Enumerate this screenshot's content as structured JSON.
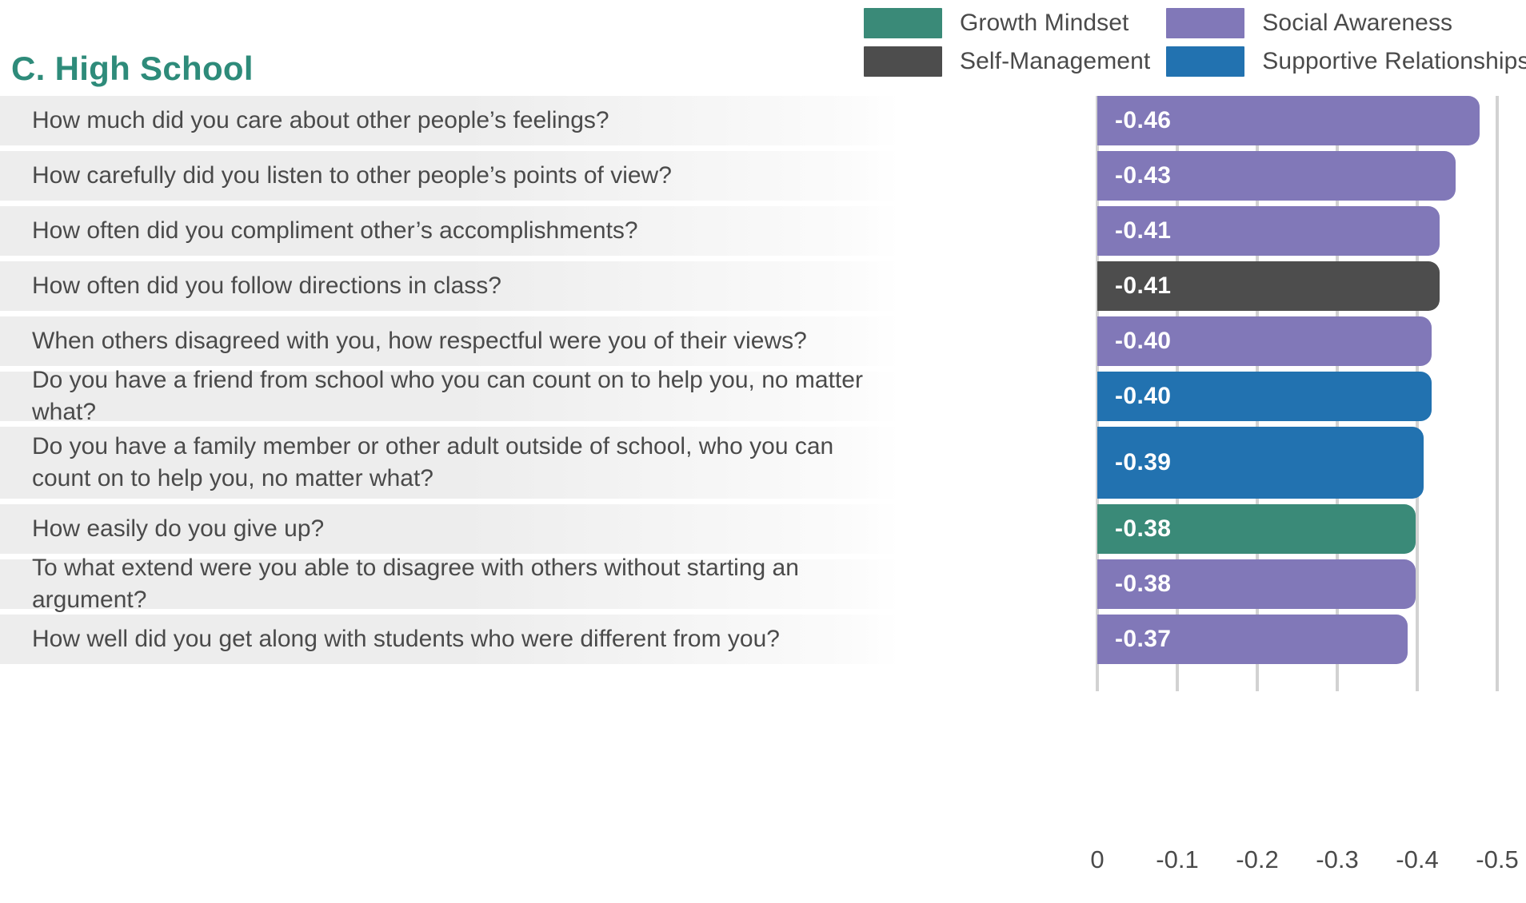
{
  "title": "C. High School",
  "legend": {
    "items": [
      {
        "label": "Growth Mindset",
        "color": "#3a8a78"
      },
      {
        "label": "Social Awareness",
        "color": "#8178b8"
      },
      {
        "label": "Self-Management",
        "color": "#4d4d4d"
      },
      {
        "label": "Supportive Relationships",
        "color": "#2272b0"
      }
    ]
  },
  "chart_data": {
    "type": "bar",
    "orientation": "horizontal",
    "title": "C. High School",
    "xlabel": "",
    "ylabel": "",
    "xlim": [
      0,
      -0.5
    ],
    "xticks": [
      "0",
      "-0.1",
      "-0.2",
      "-0.3",
      "-0.4",
      "-0.5"
    ],
    "xtick_values": [
      0,
      -0.1,
      -0.2,
      -0.3,
      -0.4,
      -0.5
    ],
    "grid": true,
    "legend_position": "top-right",
    "categories": [
      "How much did you care about other people’s feelings?",
      "How carefully did you listen to other people’s points of view?",
      "How often did you compliment other’s accomplishments?",
      "How often did you follow directions in class?",
      "When others disagreed with you, how respectful were you of their views?",
      "Do you have a friend from school who you can count on to help you, no matter what?",
      "Do you have a family member or other adult outside of school, who you can count on to help you, no matter what?",
      "How easily do you give up?",
      "To what extend were you able to disagree with others without starting an argument?",
      "How well did you get along with students who were different from you?"
    ],
    "values": [
      -0.46,
      -0.43,
      -0.41,
      -0.41,
      -0.4,
      -0.4,
      -0.39,
      -0.38,
      -0.38,
      -0.37
    ],
    "labels": [
      "-0.46",
      "-0.43",
      "-0.41",
      "-0.41",
      "-0.40",
      "-0.40",
      "-0.39",
      "-0.38",
      "-0.38",
      "-0.37"
    ],
    "series_names": [
      "Social Awareness",
      "Social Awareness",
      "Social Awareness",
      "Self-Management",
      "Social Awareness",
      "Supportive Relationships",
      "Supportive Relationships",
      "Growth Mindset",
      "Social Awareness",
      "Social Awareness"
    ],
    "colors": [
      "#8178b8",
      "#8178b8",
      "#8178b8",
      "#4d4d4d",
      "#8178b8",
      "#2272b0",
      "#2272b0",
      "#3a8a78",
      "#8178b8",
      "#8178b8"
    ]
  }
}
